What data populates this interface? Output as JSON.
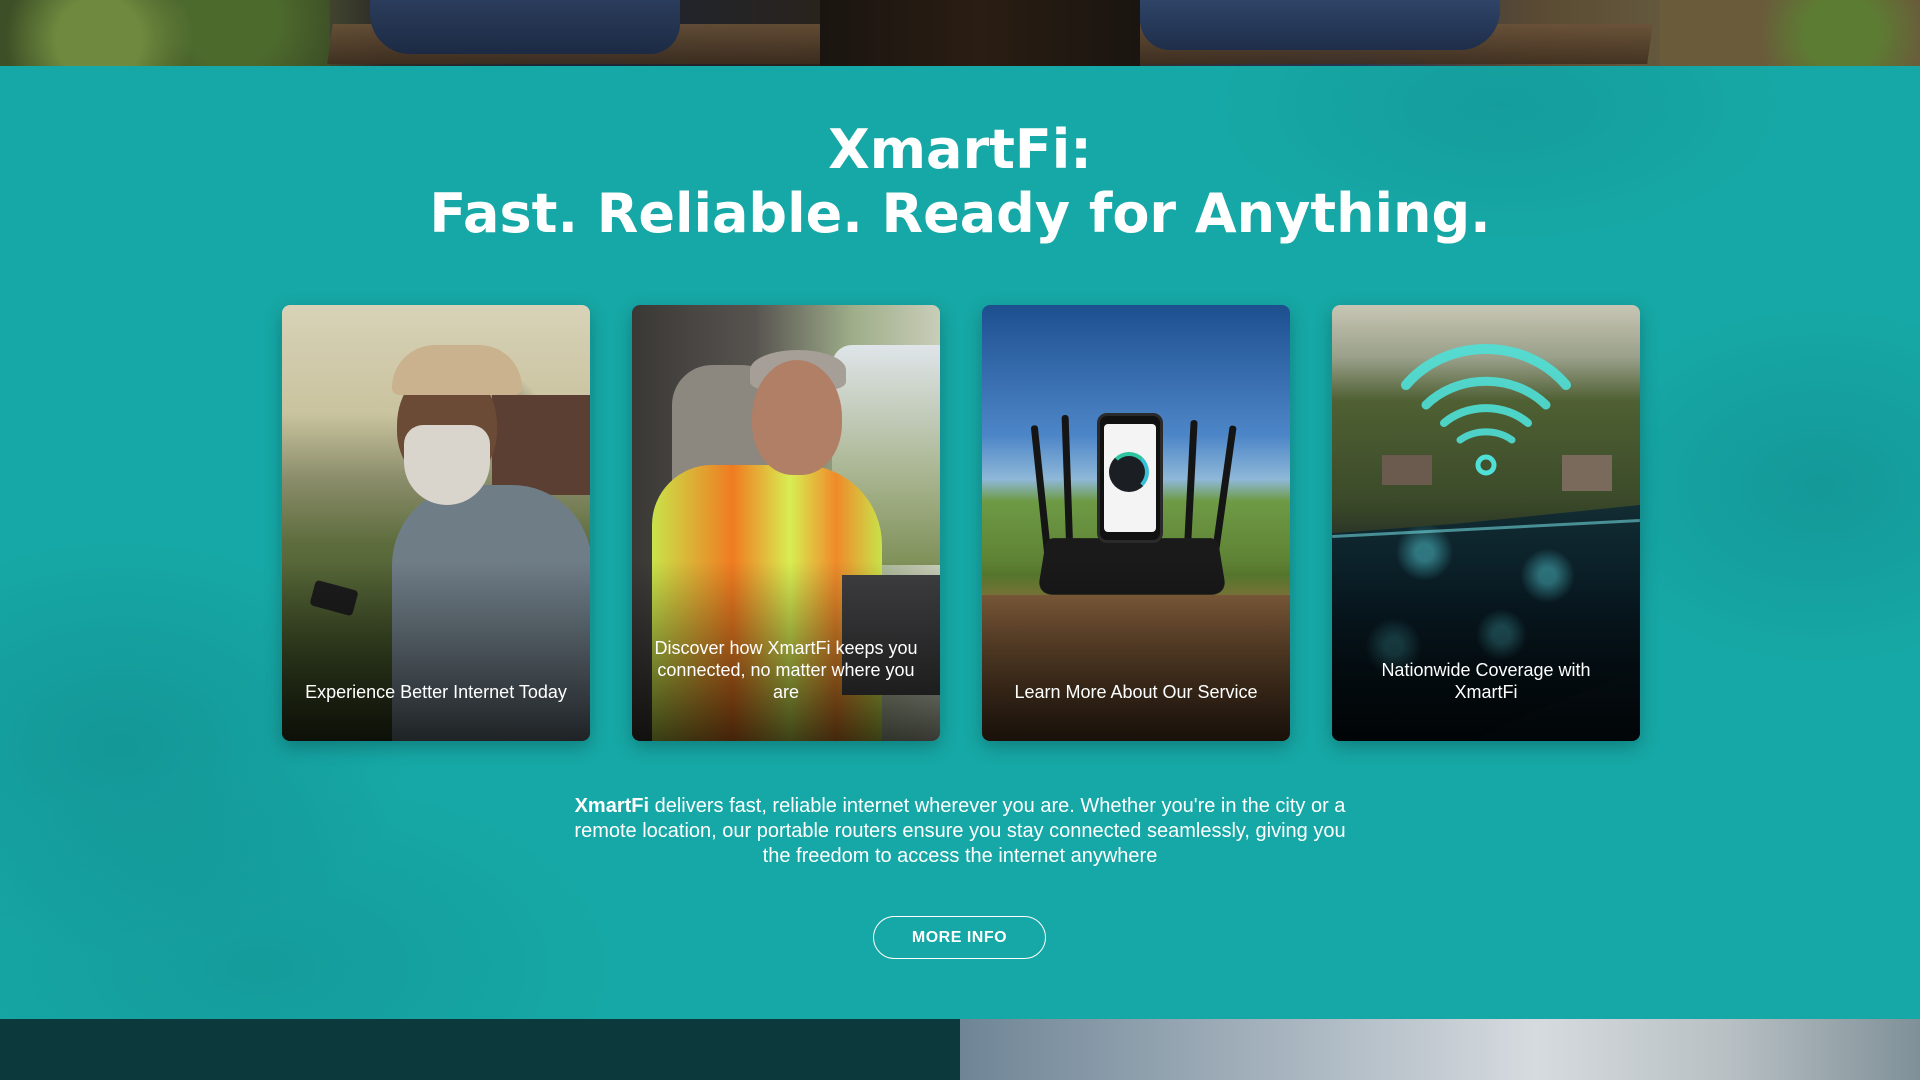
{
  "hero": {
    "title_line1": "XmartFi:",
    "title_line2": "Fast. Reliable. Ready for Anything."
  },
  "cards": [
    {
      "caption": "Experience Better Internet Today",
      "image": "farmer-with-phone"
    },
    {
      "caption": "Discover how XmartFi keeps you connected, no matter where you are",
      "image": "worker-in-van-with-laptop"
    },
    {
      "caption": "Learn More About Our Service",
      "image": "router-with-phone-speedtest"
    },
    {
      "caption": "Nationwide Coverage with XmartFi",
      "image": "wifi-over-us-map"
    }
  ],
  "blurb": {
    "brand": "XmartFi",
    "text": " delivers fast, reliable internet wherever you are. Whether you're in the city or a remote location, our portable routers ensure you stay connected seamlessly, giving you the freedom to access the internet anywhere"
  },
  "cta": {
    "label": "MORE INFO"
  },
  "colors": {
    "section_bg": "#16a8a6",
    "text": "#ffffff",
    "footer_dark": "#0c3a3c",
    "wifi_glow": "#4fe0d8"
  }
}
